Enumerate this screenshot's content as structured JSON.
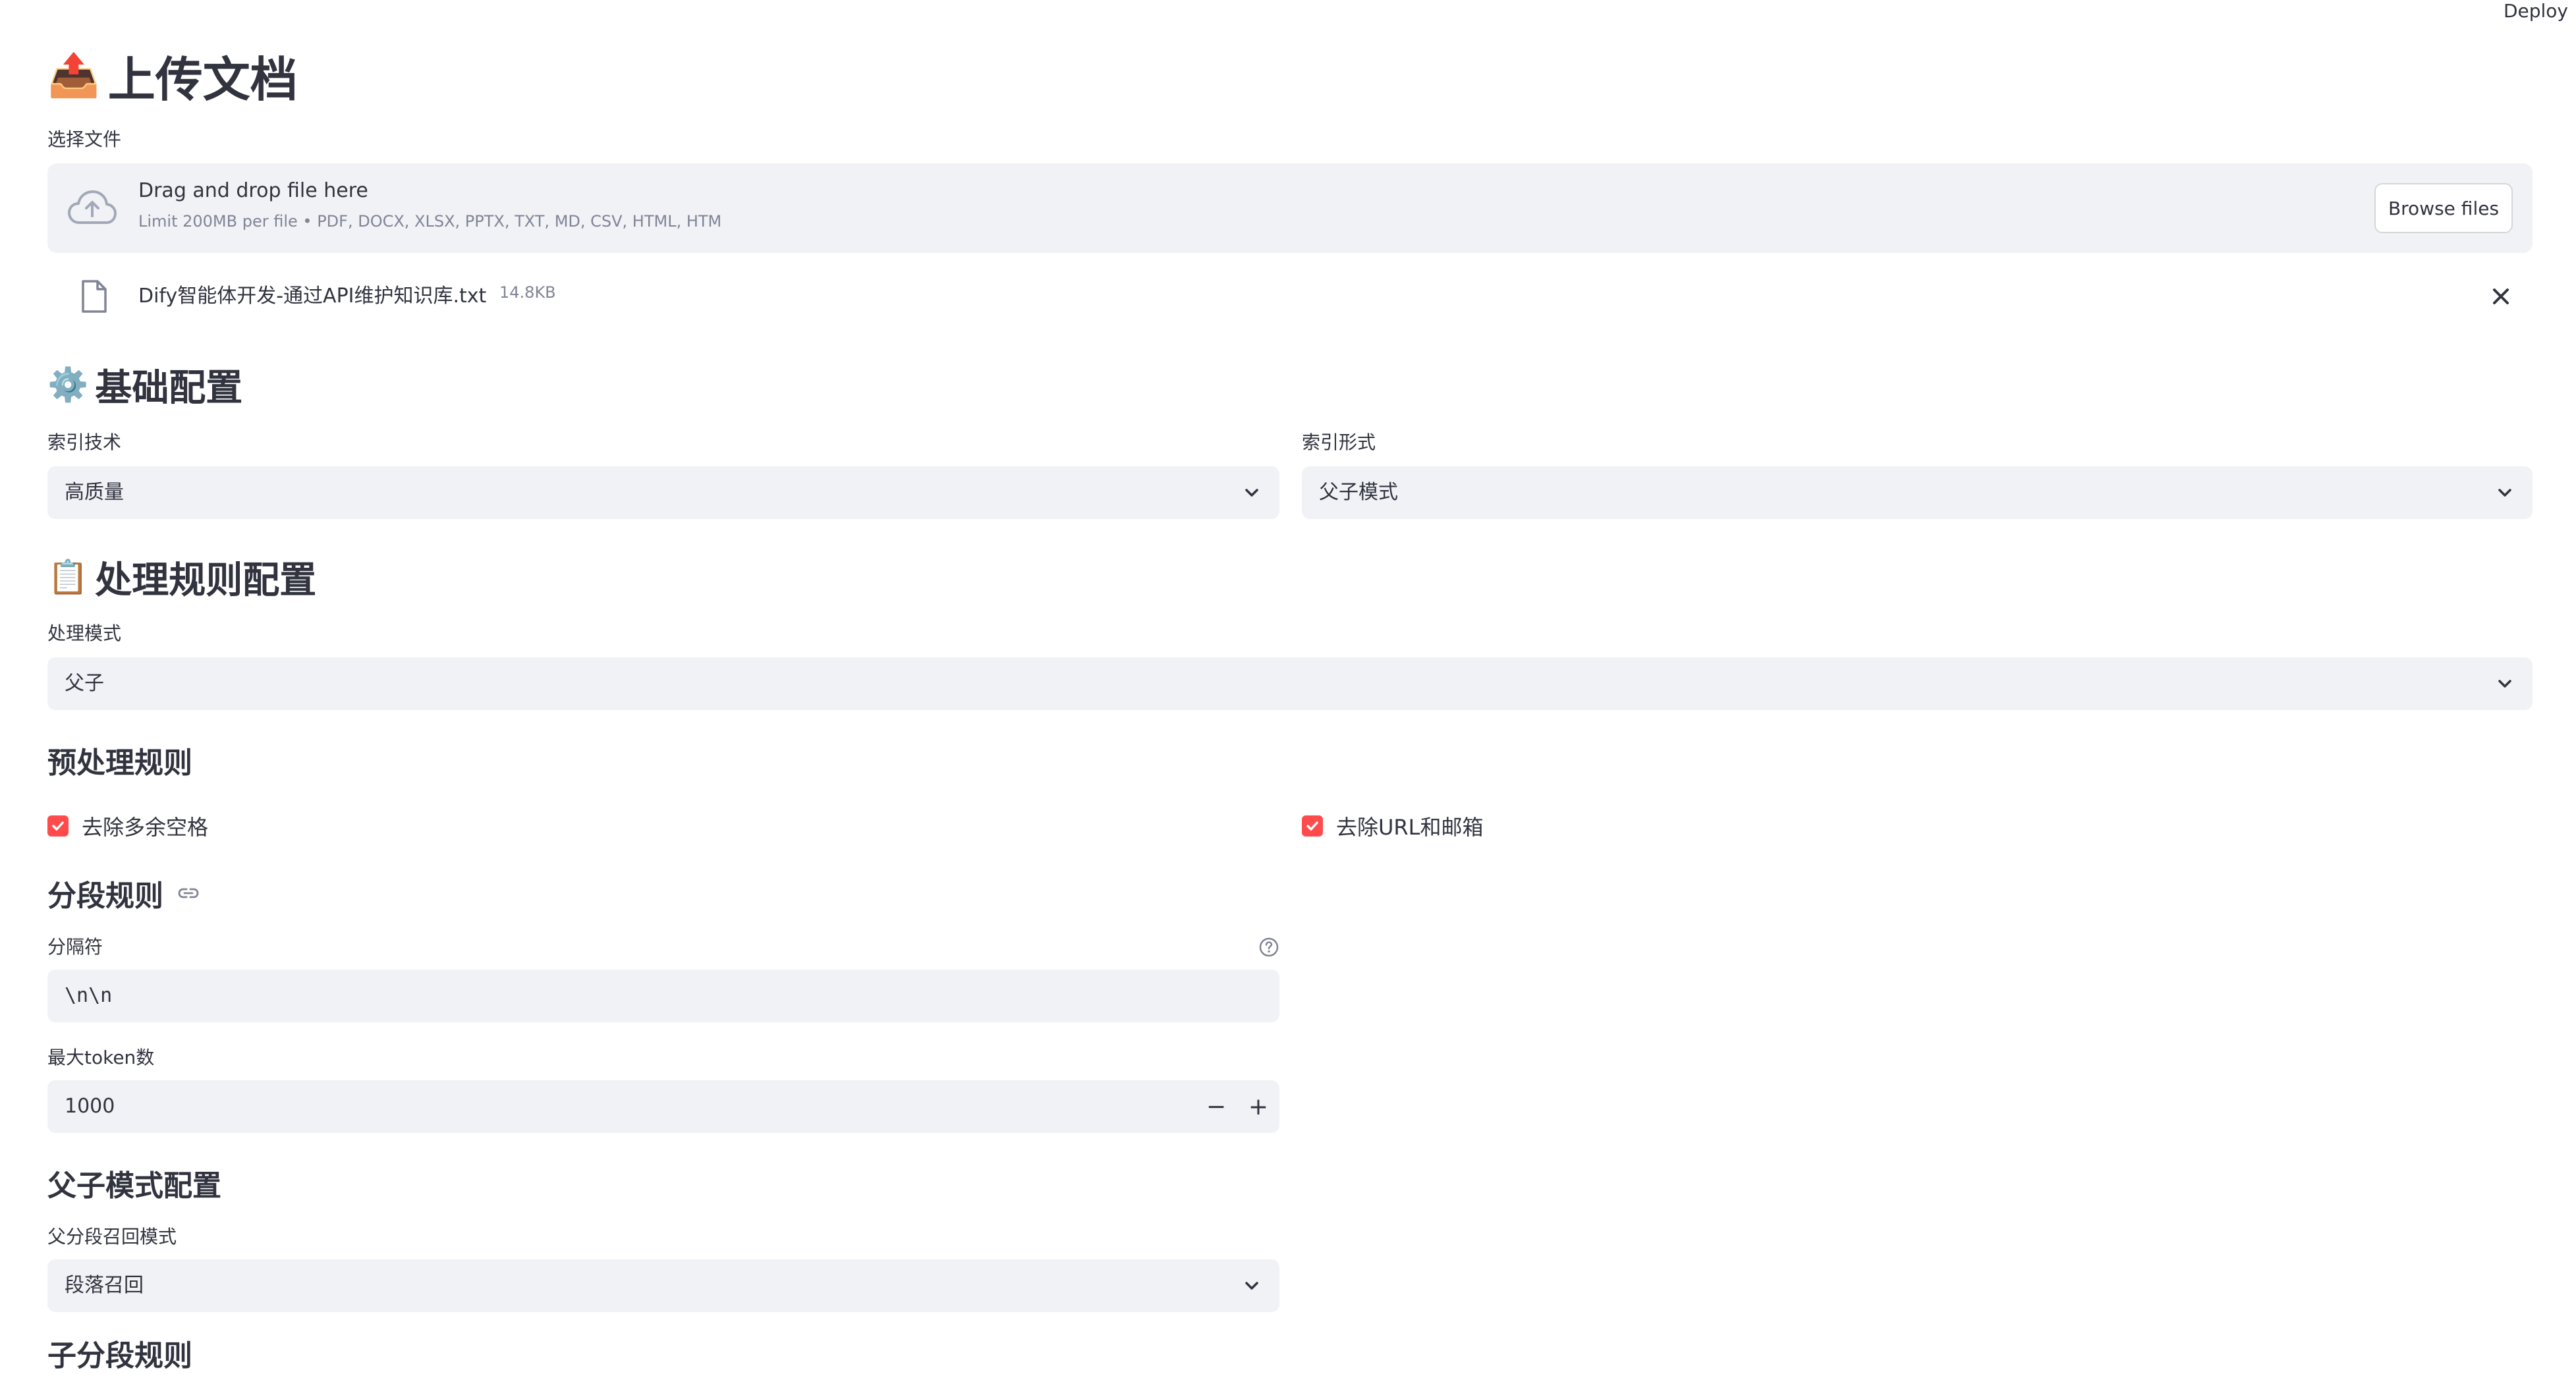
{
  "header": {
    "deploy_label": "Deploy"
  },
  "upload": {
    "emoji": "📤",
    "title": "上传文档",
    "field_label": "选择文件",
    "dropzone_title": "Drag and drop file here",
    "dropzone_sub": "Limit 200MB per file • PDF, DOCX, XLSX, PPTX, TXT, MD, CSV, HTML, HTM",
    "browse_label": "Browse files",
    "file": {
      "name": "Dify智能体开发-通过API维护知识库.txt",
      "size": "14.8KB"
    }
  },
  "basic_config": {
    "emoji": "⚙️",
    "title": "基础配置",
    "index_tech": {
      "label": "索引技术",
      "value": "高质量"
    },
    "index_form": {
      "label": "索引形式",
      "value": "父子模式"
    }
  },
  "rule_config": {
    "emoji": "📋",
    "title": "处理规则配置",
    "mode": {
      "label": "处理模式",
      "value": "父子"
    }
  },
  "preprocess": {
    "title": "预处理规则",
    "remove_spaces": "去除多余空格",
    "remove_urls": "去除URL和邮箱"
  },
  "segmentation": {
    "title": "分段规则",
    "separator": {
      "label": "分隔符",
      "value": "\\n\\n"
    },
    "max_tokens": {
      "label": "最大token数",
      "value": "1000",
      "minus": "−",
      "plus": "+"
    }
  },
  "parent_child": {
    "title": "父子模式配置",
    "recall_mode": {
      "label": "父分段召回模式",
      "value": "段落召回"
    }
  },
  "child_segment": {
    "title": "子分段规则"
  },
  "colors": {
    "accent": "#ff4b4b",
    "text": "#31333f",
    "muted": "#808495",
    "field_bg": "#f0f2f6"
  }
}
